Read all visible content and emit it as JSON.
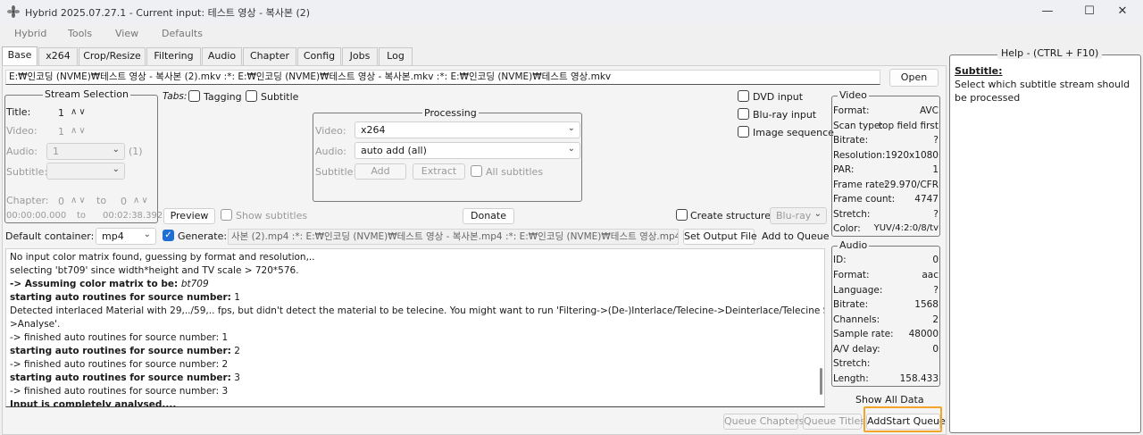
{
  "window": {
    "title": "Hybrid 2025.07.27.1 - Current input: 테스트 영상 - 복사본 (2)",
    "minimize": "—",
    "maximize": "☐",
    "close": "✕"
  },
  "menu": [
    "Hybrid",
    "Tools",
    "View",
    "Defaults"
  ],
  "tabs": [
    "Base",
    "x264",
    "Crop/Resize",
    "Filtering",
    "Audio",
    "Chapter",
    "Config",
    "Jobs",
    "Log"
  ],
  "input_path": "E:₩인코딩 (NVME)₩테스트 영상 - 복사본 (2).mkv :*: E:₩인코딩 (NVME)₩테스트 영상 - 복사본.mkv :*: E:₩인코딩 (NVME)₩테스트 영상.mkv",
  "open_button": "Open",
  "stream_selection": {
    "title": "Stream Selection",
    "title_label": "Title:",
    "title_value": "1",
    "video_label": "Video:",
    "video_value": "1",
    "audio_label": "Audio:",
    "audio_value": "1",
    "audio_count": "(1)",
    "subtitle_label": "Subtitle:",
    "chapter_label": "Chapter:",
    "chapter_from": "0",
    "to_label": "to",
    "chapter_to": "0",
    "time_from": "00:00:00.000",
    "time_to_label": "to",
    "time_to": "00:02:38.392"
  },
  "tabs_row": {
    "label": "Tabs:",
    "tagging": "Tagging",
    "subtitle": "Subtitle"
  },
  "input_options": {
    "dvd": "DVD input",
    "bluray": "Blu-ray input",
    "image_seq": "Image sequence"
  },
  "processing": {
    "title": "Processing",
    "video_label": "Video:",
    "video_value": "x264",
    "audio_label": "Audio:",
    "audio_value": "auto add (all)",
    "subtitle_label": "Subtitle:",
    "add": "Add",
    "extract": "Extract",
    "all_subtitles": "All subtitles"
  },
  "preview_button": "Preview",
  "show_subtitles": "Show subtitles",
  "donate_button": "Donate",
  "create_structure": "Create structure:",
  "structure_value": "Blu-ray",
  "output": {
    "default_container_label": "Default container:",
    "container_value": "mp4",
    "generate_label": "Generate:",
    "generate_checked": true,
    "output_path": "사본 (2).mp4 :*: E:₩인코딩 (NVME)₩테스트 영상 - 복사본.mp4 :*: E:₩인코딩 (NVME)₩테스트 영상.mp4",
    "set_output_file": "Set Output File",
    "add_to_queue": "Add to Queue"
  },
  "log": [
    {
      "text": "No input color matrix found, guessing by format and resolution,..",
      "style": "normal"
    },
    {
      "text": "  selecting 'bt709' since width*height and TV scale > 720*576.",
      "style": "normal"
    },
    {
      "text": "-> Assuming color matrix to be: ",
      "style": "bold",
      "italic_tail": "bt709"
    },
    {
      "text": "starting auto routines for source number:",
      "style": "bold",
      "tail": " 1"
    },
    {
      "text": " Detected interlaced Material with 29,../59,.. fps, but didn't detect the material to be telecine. You might want to run 'Filtering->(De-)Interlace/Telecine->Deinterlace/Telecine Settings-",
      "style": "normal"
    },
    {
      "text": ">Analyse'.",
      "style": "normal"
    },
    {
      "text": " -> finished auto routines for source number: 1",
      "style": "normal"
    },
    {
      "text": "starting auto routines for source number:",
      "style": "bold",
      "tail": " 2"
    },
    {
      "text": " -> finished auto routines for source number: 2",
      "style": "normal"
    },
    {
      "text": "starting auto routines for source number:",
      "style": "bold",
      "tail": " 3"
    },
    {
      "text": " -> finished auto routines for source number: 3",
      "style": "normal"
    },
    {
      "text": "Input is completely analysed,...",
      "style": "bold"
    }
  ],
  "video_info": {
    "title": "Video",
    "rows": [
      {
        "k": "Format:",
        "v": "AVC"
      },
      {
        "k": "Scan type:",
        "v": "top field first"
      },
      {
        "k": "Bitrate:",
        "v": "?"
      },
      {
        "k": "Resolution:",
        "v": "1920x1080"
      },
      {
        "k": "PAR:",
        "v": "1"
      },
      {
        "k": "Frame rate:",
        "v": "29.970/CFR"
      },
      {
        "k": "Frame count:",
        "v": "4747"
      },
      {
        "k": "Stretch:",
        "v": "?"
      },
      {
        "k": "Color:",
        "v": "YUV/4:2:0/8/tv"
      }
    ]
  },
  "audio_info": {
    "title": "Audio",
    "rows": [
      {
        "k": "ID:",
        "v": "0"
      },
      {
        "k": "Format:",
        "v": "aac"
      },
      {
        "k": "Language:",
        "v": "?"
      },
      {
        "k": "Bitrate:",
        "v": "1568"
      },
      {
        "k": "Channels:",
        "v": "2"
      },
      {
        "k": "Sample rate:",
        "v": "48000"
      },
      {
        "k": "A/V delay:",
        "v": "0"
      },
      {
        "k": "Stretch:",
        "v": ""
      },
      {
        "k": "Length:",
        "v": "158.433"
      }
    ]
  },
  "show_all_data": "Show All Data",
  "bottom_buttons": {
    "queue_chapters": "Queue Chapters",
    "queue_titles": "Queue Titles",
    "add_start_queue": "AddStart Queue"
  },
  "help": {
    "title": "Help - (CTRL + F10)",
    "subtitle": "Subtitle:",
    "text": "Select which subtitle stream should be processed"
  },
  "colors": {
    "accent": "#1f6ed4",
    "highlight": "#f3a52a"
  }
}
